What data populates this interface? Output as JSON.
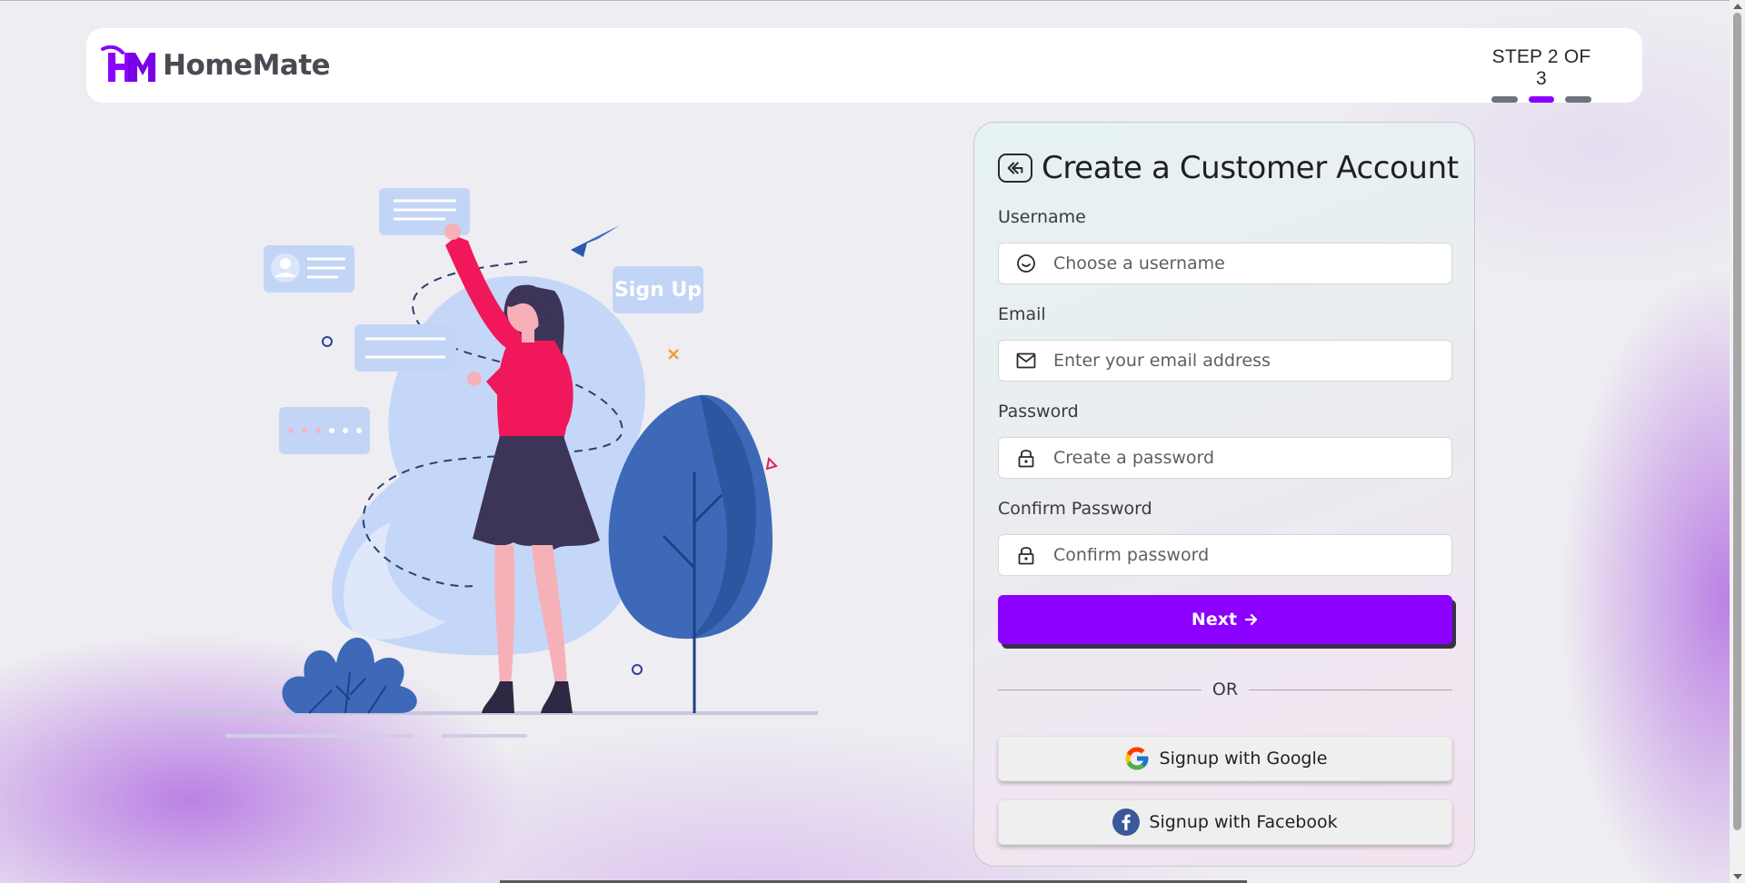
{
  "brand": {
    "name": "HomeMate",
    "accent": "#8b00ff"
  },
  "progress": {
    "label": "STEP 2 OF 3",
    "current_step": 2,
    "total_steps": 3
  },
  "illustration": {
    "badge_text": "Sign Up"
  },
  "form": {
    "title": "Create a Customer Account",
    "back_icon": "back-arrow-icon",
    "fields": {
      "username": {
        "label": "Username",
        "placeholder": "Choose a username",
        "value": "",
        "icon": "smile-icon"
      },
      "email": {
        "label": "Email",
        "placeholder": "Enter your email address",
        "value": "",
        "icon": "envelope-icon"
      },
      "password": {
        "label": "Password",
        "placeholder": "Create a password",
        "value": "",
        "icon": "lock-icon"
      },
      "confirm_password": {
        "label": "Confirm Password",
        "placeholder": "Confirm password",
        "value": "",
        "icon": "lock-icon"
      }
    },
    "next_label": "Next",
    "divider_text": "OR",
    "google_label": "Signup with Google",
    "facebook_label": "Signup with Facebook"
  },
  "colors": {
    "primary": "#8b00ff",
    "step_inactive": "#6c757d",
    "facebook": "#3b5998"
  }
}
